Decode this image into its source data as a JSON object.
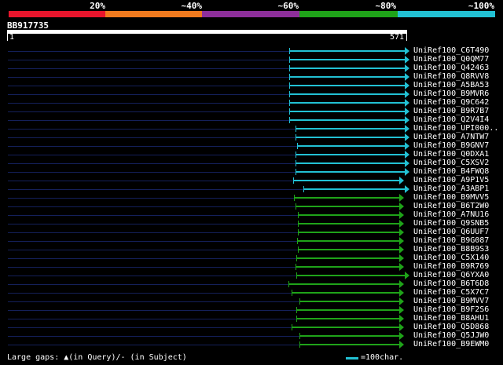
{
  "colors": {
    "background": "#000000",
    "track": "#14205a",
    "hit_cyan": "#22c1d4",
    "hit_green": "#1fa319",
    "ruler": "#ffffff"
  },
  "legend": {
    "labels": [
      "20%",
      "~40%",
      "~60%",
      "~80%",
      "~100%"
    ],
    "colors": [
      "#e8152c",
      "#f07a1e",
      "#8e2f9b",
      "#1fa319",
      "#22c1d4"
    ]
  },
  "query": {
    "name": "BB917735",
    "ruler_start": "1",
    "ruler_end": "571"
  },
  "footer": {
    "gaps_text": "Large gaps: ▲(in Query)/- (in Subject)",
    "scale_label": "=100char.",
    "scale_color": "#22c1d4"
  },
  "hits": [
    {
      "name": "UniRef100_C6T490",
      "color": "cyan",
      "start": 405,
      "end": 571,
      "full_arrow": true
    },
    {
      "name": "UniRef100_Q0QM77",
      "color": "cyan",
      "start": 405,
      "end": 571,
      "full_arrow": true
    },
    {
      "name": "UniRef100_Q42463",
      "color": "cyan",
      "start": 405,
      "end": 571,
      "full_arrow": true
    },
    {
      "name": "UniRef100_Q8RVV8",
      "color": "cyan",
      "start": 405,
      "end": 571,
      "full_arrow": true
    },
    {
      "name": "UniRef100_A5BA53",
      "color": "cyan",
      "start": 405,
      "end": 571,
      "full_arrow": true
    },
    {
      "name": "UniRef100_B9MVR6",
      "color": "cyan",
      "start": 405,
      "end": 571,
      "full_arrow": true
    },
    {
      "name": "UniRef100_Q9C642",
      "color": "cyan",
      "start": 405,
      "end": 571,
      "full_arrow": true
    },
    {
      "name": "UniRef100_B9R7B7",
      "color": "cyan",
      "start": 405,
      "end": 571,
      "full_arrow": true
    },
    {
      "name": "UniRef100_Q2V4I4",
      "color": "cyan",
      "start": 405,
      "end": 571,
      "full_arrow": true
    },
    {
      "name": "UniRef100_UPI000..",
      "color": "cyan",
      "start": 414,
      "end": 571,
      "full_arrow": true
    },
    {
      "name": "UniRef100_A7NTW7",
      "color": "cyan",
      "start": 414,
      "end": 571,
      "full_arrow": true
    },
    {
      "name": "UniRef100_B9GNV7",
      "color": "cyan",
      "start": 416,
      "end": 571,
      "full_arrow": true
    },
    {
      "name": "UniRef100_Q0DXA1",
      "color": "cyan",
      "start": 414,
      "end": 571,
      "full_arrow": true
    },
    {
      "name": "UniRef100_C5XSV2",
      "color": "cyan",
      "start": 414,
      "end": 571,
      "full_arrow": true
    },
    {
      "name": "UniRef100_B4FWQ8",
      "color": "cyan",
      "start": 414,
      "end": 571,
      "full_arrow": true
    },
    {
      "name": "UniRef100_A9P1V5",
      "color": "cyan",
      "start": 411,
      "end": 563,
      "full_arrow": false
    },
    {
      "name": "UniRef100_A3ABP1",
      "color": "cyan",
      "start": 425,
      "end": 571,
      "full_arrow": true
    },
    {
      "name": "UniRef100_B9MVV5",
      "color": "green",
      "start": 412,
      "end": 563,
      "full_arrow": false
    },
    {
      "name": "UniRef100_B6T2W0",
      "color": "green",
      "start": 414,
      "end": 563,
      "full_arrow": false
    },
    {
      "name": "UniRef100_A7NU16",
      "color": "green",
      "start": 418,
      "end": 563,
      "full_arrow": false
    },
    {
      "name": "UniRef100_Q9SNB5",
      "color": "green",
      "start": 418,
      "end": 563,
      "full_arrow": false
    },
    {
      "name": "UniRef100_Q6UUF7",
      "color": "green",
      "start": 418,
      "end": 563,
      "full_arrow": false
    },
    {
      "name": "UniRef100_B9G087",
      "color": "green",
      "start": 416,
      "end": 563,
      "full_arrow": false
    },
    {
      "name": "UniRef100_B8B9S3",
      "color": "green",
      "start": 418,
      "end": 563,
      "full_arrow": false
    },
    {
      "name": "UniRef100_C5X140",
      "color": "green",
      "start": 415,
      "end": 563,
      "full_arrow": false
    },
    {
      "name": "UniRef100_B9R769",
      "color": "green",
      "start": 414,
      "end": 563,
      "full_arrow": false
    },
    {
      "name": "UniRef100_Q6YXA0",
      "color": "green",
      "start": 415,
      "end": 571,
      "full_arrow": true
    },
    {
      "name": "UniRef100_B6T6D8",
      "color": "green",
      "start": 404,
      "end": 563,
      "full_arrow": false
    },
    {
      "name": "UniRef100_C5X7C7",
      "color": "green",
      "start": 408,
      "end": 563,
      "full_arrow": false
    },
    {
      "name": "UniRef100_B9MVV7",
      "color": "green",
      "start": 420,
      "end": 563,
      "full_arrow": false
    },
    {
      "name": "UniRef100_B9F2S6",
      "color": "green",
      "start": 415,
      "end": 563,
      "full_arrow": false
    },
    {
      "name": "UniRef100_B8AHU1",
      "color": "green",
      "start": 415,
      "end": 563,
      "full_arrow": false
    },
    {
      "name": "UniRef100_Q5D868",
      "color": "green",
      "start": 408,
      "end": 563,
      "full_arrow": false
    },
    {
      "name": "UniRef100_Q5JJW0",
      "color": "green",
      "start": 420,
      "end": 563,
      "full_arrow": false
    },
    {
      "name": "UniRef100_B9EWM0",
      "color": "green",
      "start": 420,
      "end": 563,
      "full_arrow": false
    }
  ]
}
